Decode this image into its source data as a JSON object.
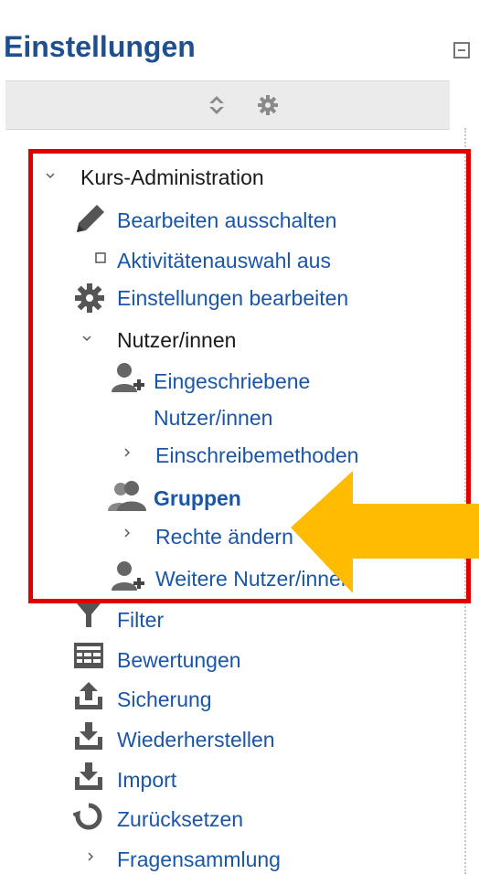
{
  "block": {
    "title": "Einstellungen"
  },
  "tree": {
    "root": {
      "label": "Kurs-Administration"
    },
    "items": {
      "edit_off": "Bearbeiten ausschalten",
      "activity_chooser_off": "Aktivitätenauswahl aus",
      "edit_settings": "Einstellungen bearbeiten",
      "users": "Nutzer/innen",
      "enrolled_users_1": "Eingeschriebene",
      "enrolled_users_2": "Nutzer/innen",
      "enrolment_methods": "Einschreibemethoden",
      "groups": "Gruppen",
      "permissions": "Rechte ändern",
      "other_users": "Weitere Nutzer/innen",
      "filter": "Filter",
      "grades": "Bewertungen",
      "backup": "Sicherung",
      "restore": "Wiederherstellen",
      "import": "Import",
      "reset": "Zurücksetzen",
      "question_bank": "Fragensammlung"
    }
  },
  "colors": {
    "link": "#1a56a8",
    "title": "#1f4f8f",
    "highlight": "#e00000",
    "arrow": "#ffbb00"
  }
}
